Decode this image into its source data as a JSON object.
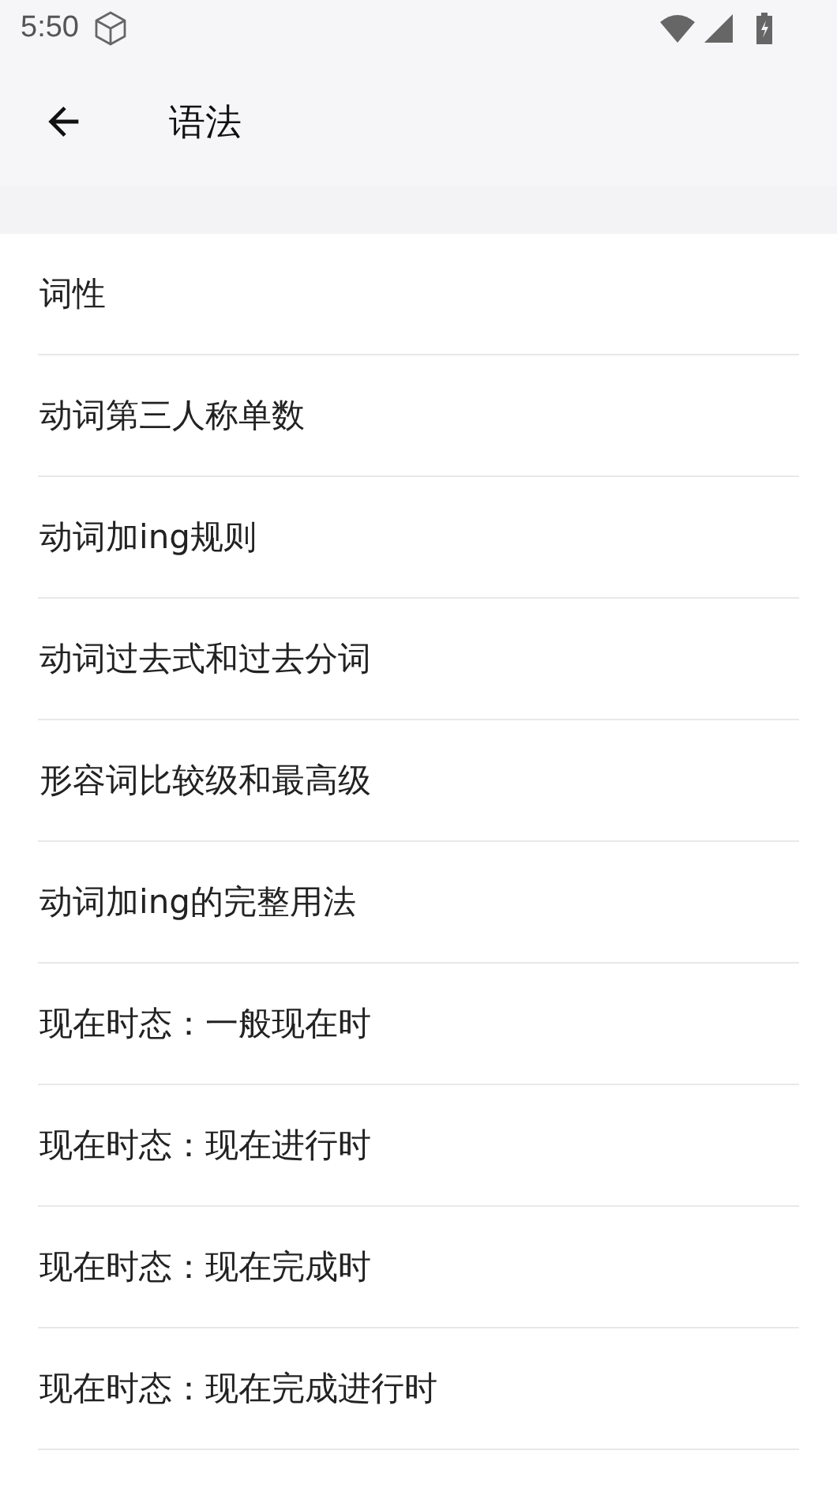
{
  "status_bar": {
    "time": "5:50"
  },
  "app_bar": {
    "title": "语法"
  },
  "items": [
    {
      "label": "词性"
    },
    {
      "label": "动词第三人称单数"
    },
    {
      "label": "动词加ing规则"
    },
    {
      "label": "动词过去式和过去分词"
    },
    {
      "label": "形容词比较级和最高级"
    },
    {
      "label": "动词加ing的完整用法"
    },
    {
      "label": "现在时态：一般现在时"
    },
    {
      "label": "现在时态：现在进行时"
    },
    {
      "label": "现在时态：现在完成时"
    },
    {
      "label": "现在时态：现在完成进行时"
    }
  ]
}
